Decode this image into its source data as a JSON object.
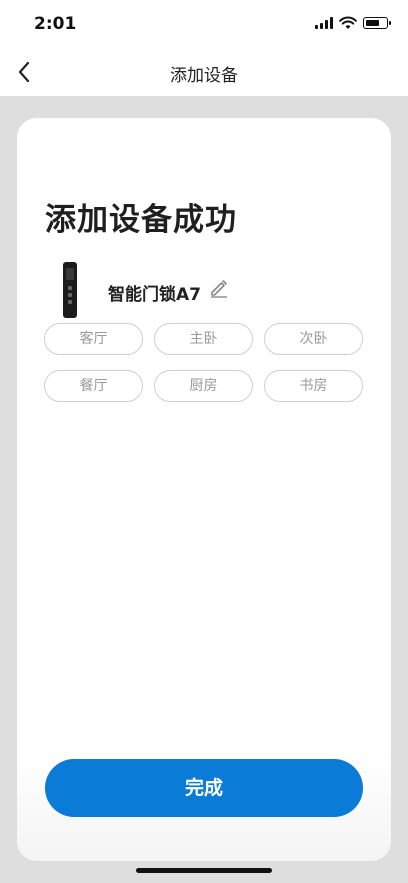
{
  "status_bar": {
    "time": "2:01",
    "battery_level": 0.7
  },
  "nav": {
    "title": "添加设备",
    "back_icon": "chevron-left-icon"
  },
  "card": {
    "title": "添加设备成功",
    "device": {
      "name": "智能门锁A7",
      "edit_icon": "pencil-icon"
    },
    "rooms": [
      "客厅",
      "主卧",
      "次卧",
      "餐厅",
      "厨房",
      "书房"
    ],
    "done_label": "完成"
  },
  "colors": {
    "accent": "#0a7bd6",
    "background": "#dedede",
    "chip_border": "#cfcfcf",
    "chip_text": "#9a9a9a"
  }
}
